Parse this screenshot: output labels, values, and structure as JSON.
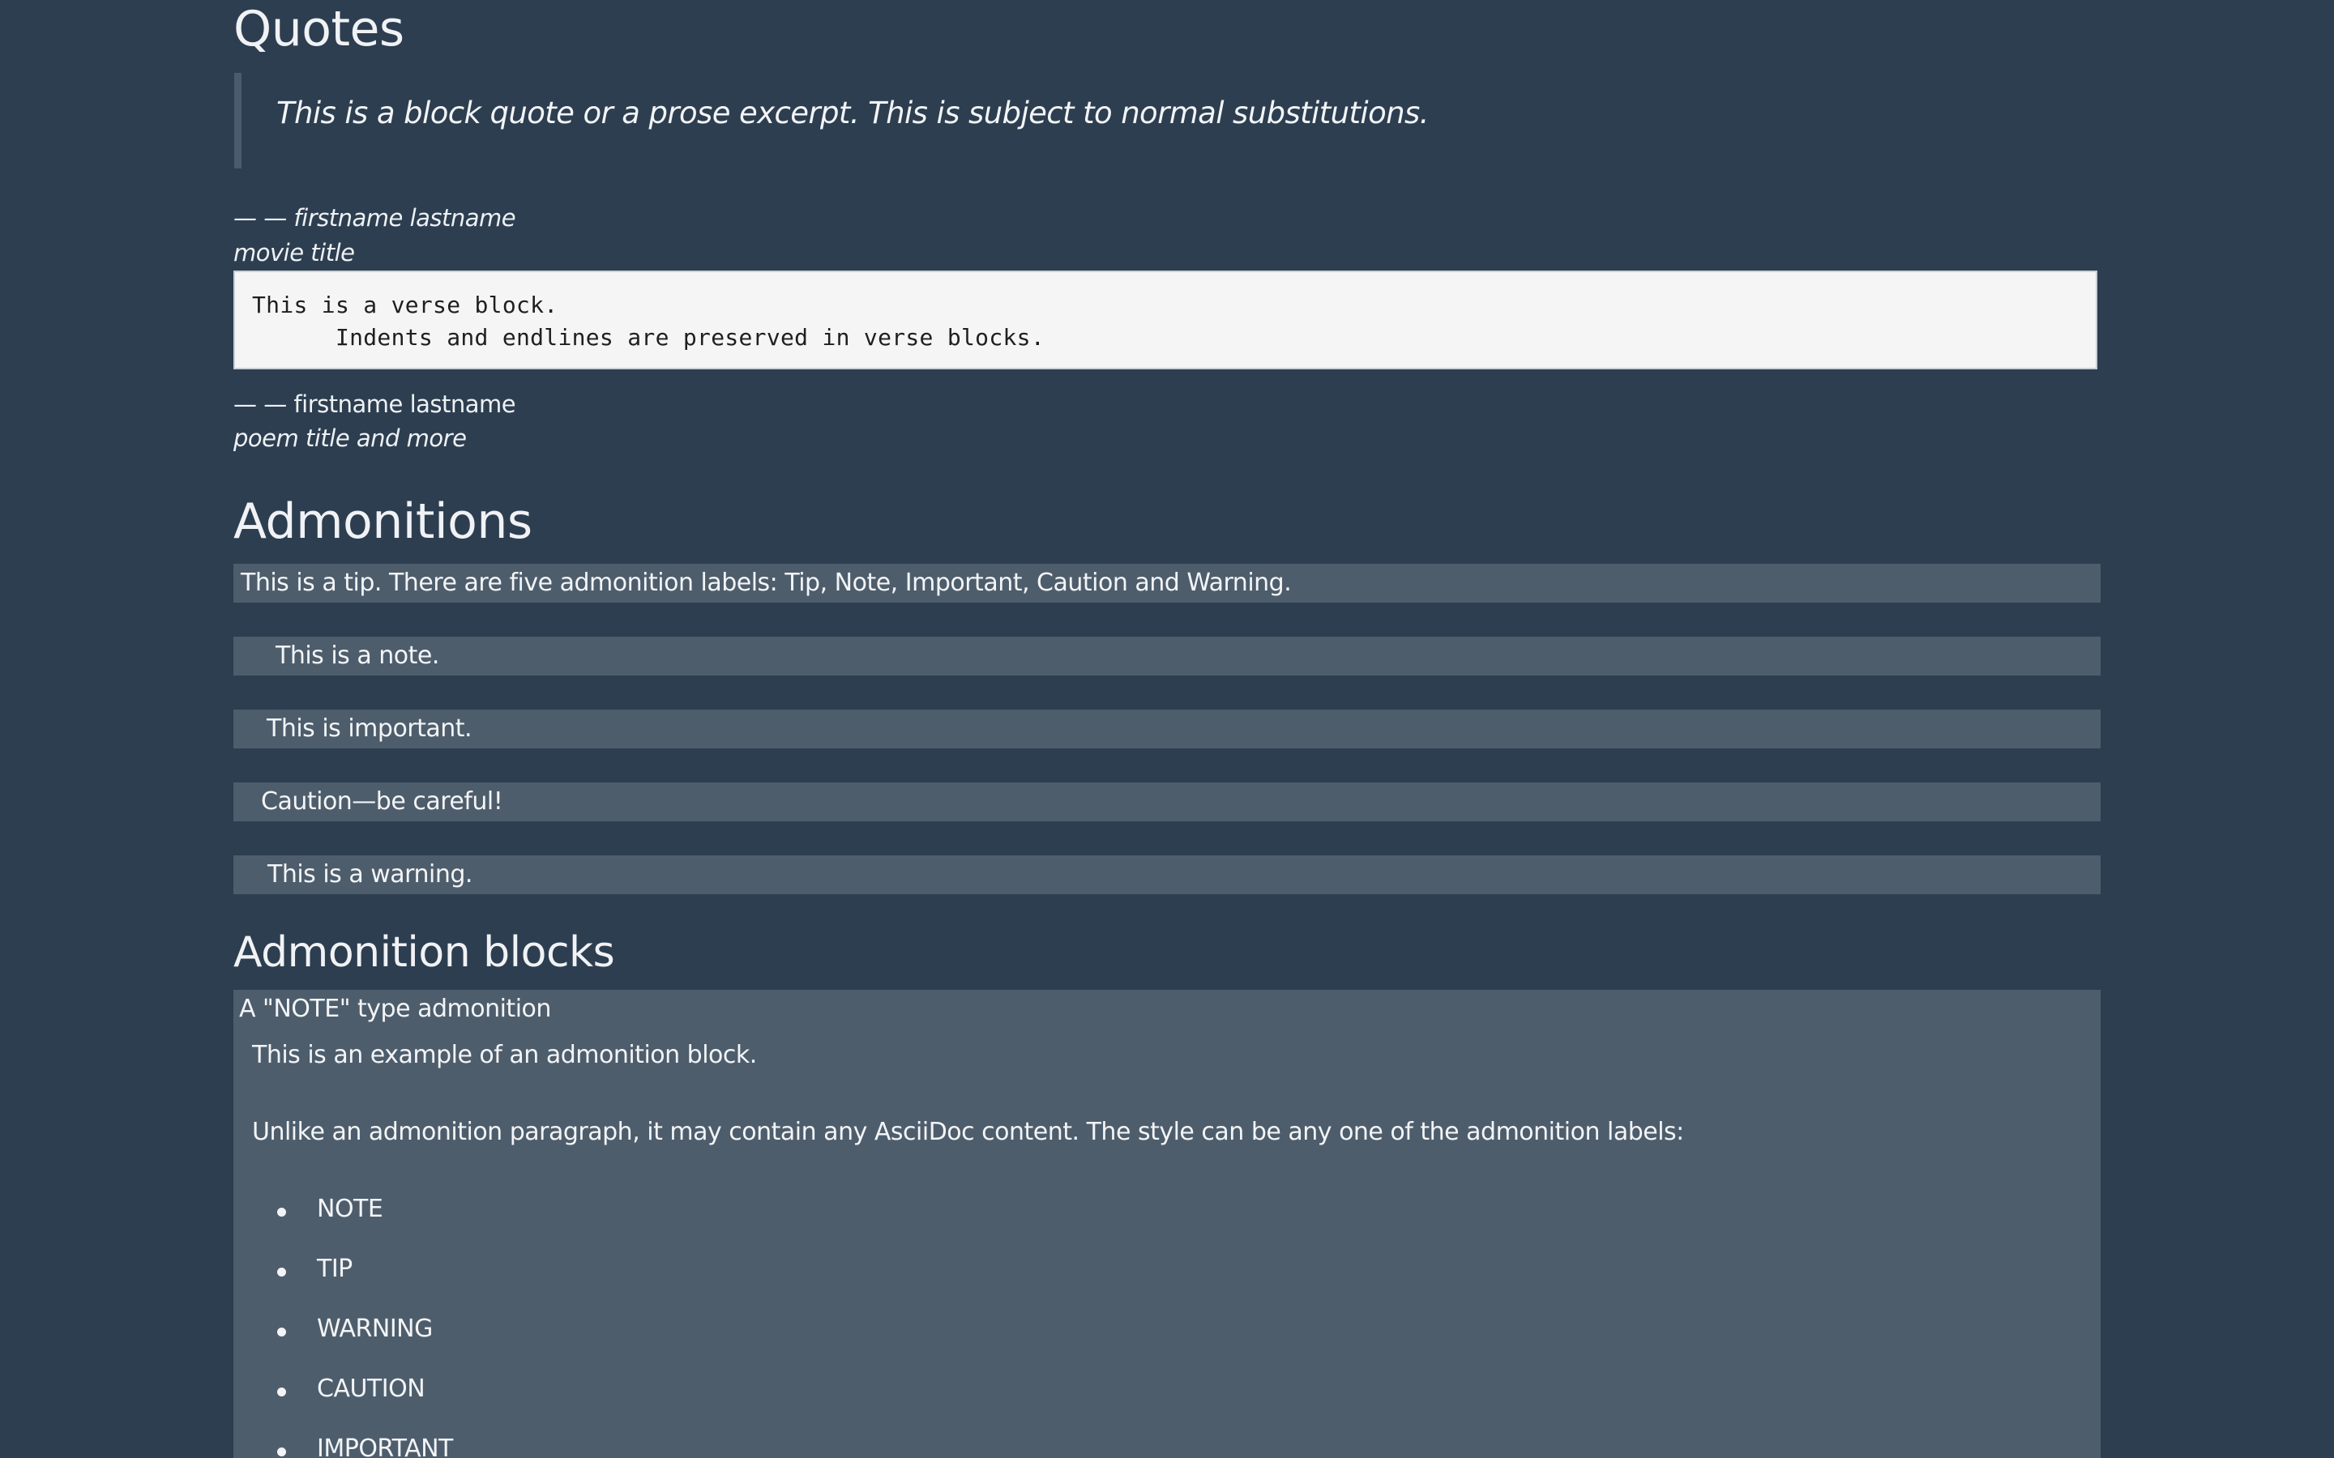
{
  "quotes": {
    "heading": "Quotes",
    "blockquote_text": "This is a block quote or a prose excerpt. This is subject to normal substitutions.",
    "quote_attribution": "— — firstname lastname",
    "quote_citation": "movie title",
    "verse_lines": [
      "This is a verse block.",
      "      Indents and endlines are preserved in verse blocks."
    ],
    "verse_attribution": "— — firstname lastname",
    "verse_citation": "poem title and more"
  },
  "admonitions": {
    "heading": "Admonitions",
    "items": [
      "This is a tip. There are five admonition labels: Tip, Note, Important, Caution and Warning.",
      "This is a note.",
      "This is important.",
      "Caution—be careful!",
      "This is a warning."
    ]
  },
  "admonition_blocks": {
    "heading": "Admonition blocks",
    "block_title": "A \"NOTE\" type admonition",
    "paragraph_1": "This is an example of an admonition block.",
    "paragraph_2": "Unlike an admonition paragraph, it may contain any AsciiDoc content. The style can be any one of the admonition labels:",
    "labels": [
      "NOTE",
      "TIP",
      "WARNING",
      "CAUTION",
      "IMPORTANT"
    ]
  },
  "colors": {
    "page_background": "#2d3e50",
    "admonition_background": "#4e5d6c",
    "verse_background": "#f5f5f5",
    "quote_border": "#4a5b6c"
  }
}
